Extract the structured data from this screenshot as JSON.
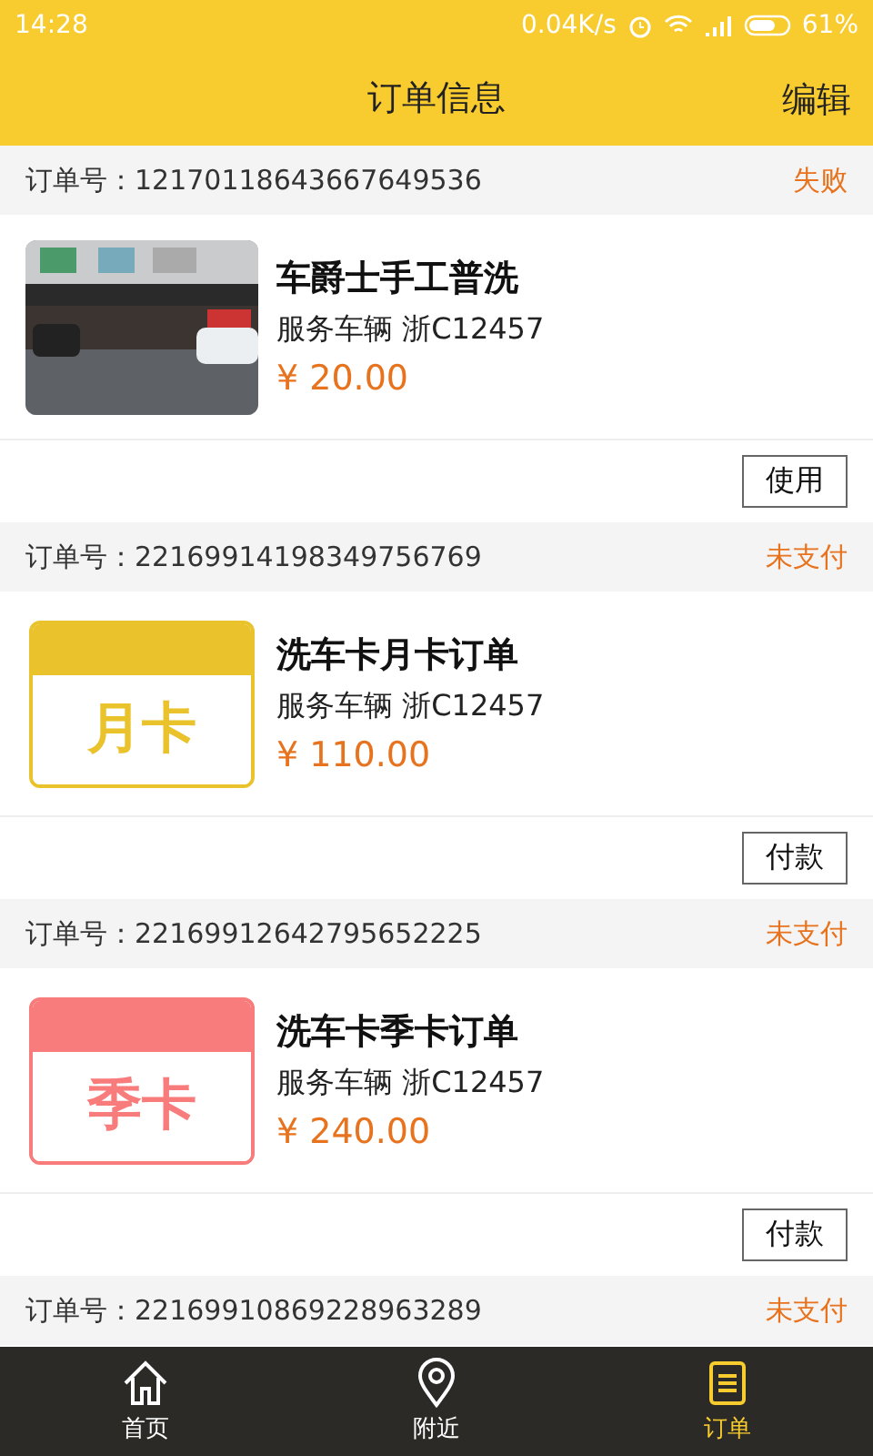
{
  "status_bar": {
    "time": "14:28",
    "speed": "0.04K/s",
    "battery": "61%"
  },
  "header": {
    "title": "订单信息",
    "action": "编辑"
  },
  "orders": [
    {
      "number_label": "订单号：",
      "number": "12170118643667649536",
      "status": "失败",
      "name": "车爵士手工普洗",
      "vehicle": "服务车辆 浙C12457",
      "price": "¥ 20.00",
      "button": "使用"
    },
    {
      "number_label": "订单号：",
      "number": "22169914198349756769",
      "status": "未支付",
      "thumb": {
        "kind": "card",
        "label": "月卡",
        "color": "#e9c22c"
      },
      "name": "洗车卡月卡订单",
      "vehicle": "服务车辆 浙C12457",
      "price": "¥ 110.00",
      "button": "付款"
    },
    {
      "number_label": "订单号：",
      "number": "22169912642795652225",
      "status": "未支付",
      "thumb": {
        "kind": "card",
        "label": "季卡",
        "color": "#f87c7c"
      },
      "name": "洗车卡季卡订单",
      "vehicle": "服务车辆 浙C12457",
      "price": "¥ 240.00",
      "button": "付款"
    },
    {
      "number_label": "订单号：",
      "number": "22169910869228963289",
      "status": "未支付"
    }
  ],
  "nav": [
    {
      "kind": "home",
      "label": "首页",
      "selected": false
    },
    {
      "kind": "location",
      "label": "附近",
      "selected": false
    },
    {
      "kind": "orders",
      "label": "订单",
      "selected": true
    }
  ]
}
